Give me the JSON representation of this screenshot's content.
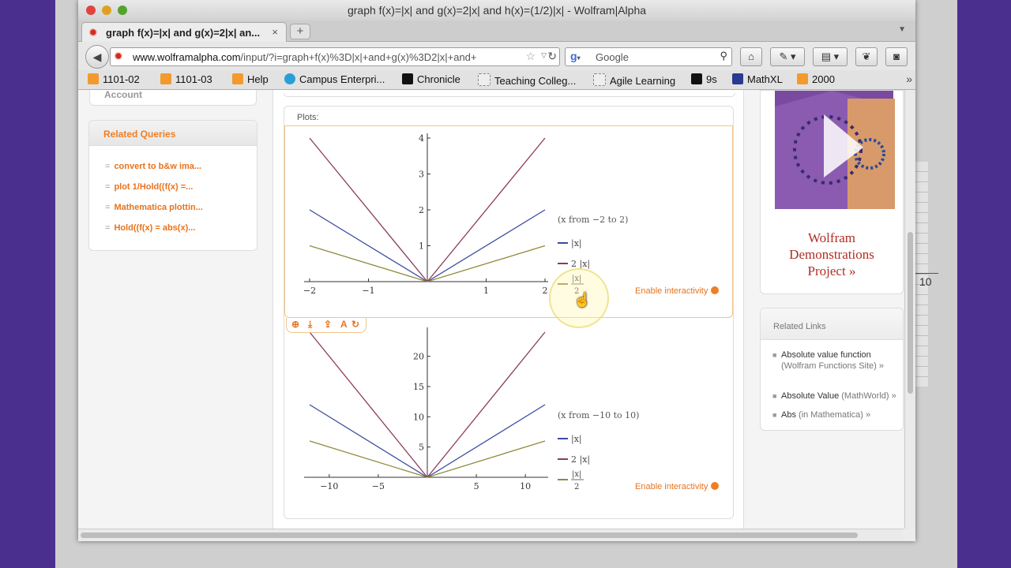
{
  "window": {
    "title": "graph f(x)=|x| and g(x)=2|x| and h(x)=(1/2)|x| - Wolfram|Alpha"
  },
  "tab": {
    "title": "graph f(x)=|x| and g(x)=2|x| an...",
    "close": "×",
    "new_tab": "+"
  },
  "navbar": {
    "url_host": "www.wolframalpha.com",
    "url_path": "/input/?i=graph+f(x)%3D|x|+and+g(x)%3D2|x|+and+",
    "search_placeholder": "Google"
  },
  "bookmarks": [
    {
      "label": "1101-02",
      "color": "#f29a2e"
    },
    {
      "label": "1101-03",
      "color": "#f29a2e"
    },
    {
      "label": "Help",
      "color": "#f29a2e"
    },
    {
      "label": "Campus Enterpri...",
      "color": "#2a9fd6"
    },
    {
      "label": "Chronicle",
      "color": "#111111"
    },
    {
      "label": "Teaching Colleg...",
      "color": "#dddddd"
    },
    {
      "label": "Agile Learning",
      "color": "#dddddd"
    },
    {
      "label": "9s",
      "color": "#111111"
    },
    {
      "label": "MathXL",
      "color": "#2a3a8f"
    },
    {
      "label": "2000",
      "color": "#f29a2e"
    }
  ],
  "sidebar_left": {
    "account_label": "Account",
    "related_queries_title": "Related Queries",
    "related_queries": [
      "convert to b&w ima...",
      "plot 1/Hold((f(x) =...",
      "Mathematica plottin...",
      "Hold((f(x) = abs(x)..."
    ]
  },
  "pod": {
    "title": "Plots:",
    "enable_interactivity": "Enable interactivity",
    "toolbar_icons": [
      "zoom-icon",
      "download-icon",
      "share-icon",
      "font-icon",
      "interactive-icon"
    ]
  },
  "chart_data": [
    {
      "type": "line",
      "title": "",
      "range_label": "(x from −2 to 2)",
      "x": [
        -2,
        0,
        2
      ],
      "xticks": [
        "−2",
        "−1",
        "1",
        "2"
      ],
      "yticks": [
        "1",
        "2",
        "3",
        "4"
      ],
      "ylim": [
        0,
        4
      ],
      "series": [
        {
          "name": "|x|",
          "values": [
            2,
            0,
            2
          ],
          "color": "#3b4a9e"
        },
        {
          "name": "2 |x|",
          "values": [
            4,
            0,
            4
          ],
          "color": "#8b3a5c"
        },
        {
          "name": "|x| / 2",
          "values": [
            1,
            0,
            1
          ],
          "color": "#8f8a3a"
        }
      ]
    },
    {
      "type": "line",
      "title": "",
      "range_label": "(x from −10 to 10)",
      "x": [
        -12,
        0,
        12
      ],
      "xticks": [
        "−10",
        "−5",
        "5",
        "10"
      ],
      "yticks": [
        "5",
        "10",
        "15",
        "20"
      ],
      "ylim": [
        0,
        24
      ],
      "series": [
        {
          "name": "|x|",
          "values": [
            12,
            0,
            12
          ],
          "color": "#3b4a9e"
        },
        {
          "name": "2 |x|",
          "values": [
            24,
            0,
            24
          ],
          "color": "#8b3a5c"
        },
        {
          "name": "|x| / 2",
          "values": [
            6,
            0,
            6
          ],
          "color": "#8f8a3a"
        }
      ]
    }
  ],
  "legend": {
    "abs": "|x|",
    "two_abs": "2 |x|",
    "half_num": "|x|",
    "half_den": "2"
  },
  "sidebar_right": {
    "demo_text": [
      "Wolfram",
      "Demonstrations",
      "Project »"
    ],
    "related_links_title": "Related Links",
    "links": [
      {
        "main": "Absolute value function",
        "note": "(Wolfram Functions Site) »"
      },
      {
        "main": "Absolute Value",
        "note": "(MathWorld) »"
      },
      {
        "main": "Abs",
        "note": "(in Mathematica) »"
      }
    ]
  },
  "ghost_label": "10"
}
